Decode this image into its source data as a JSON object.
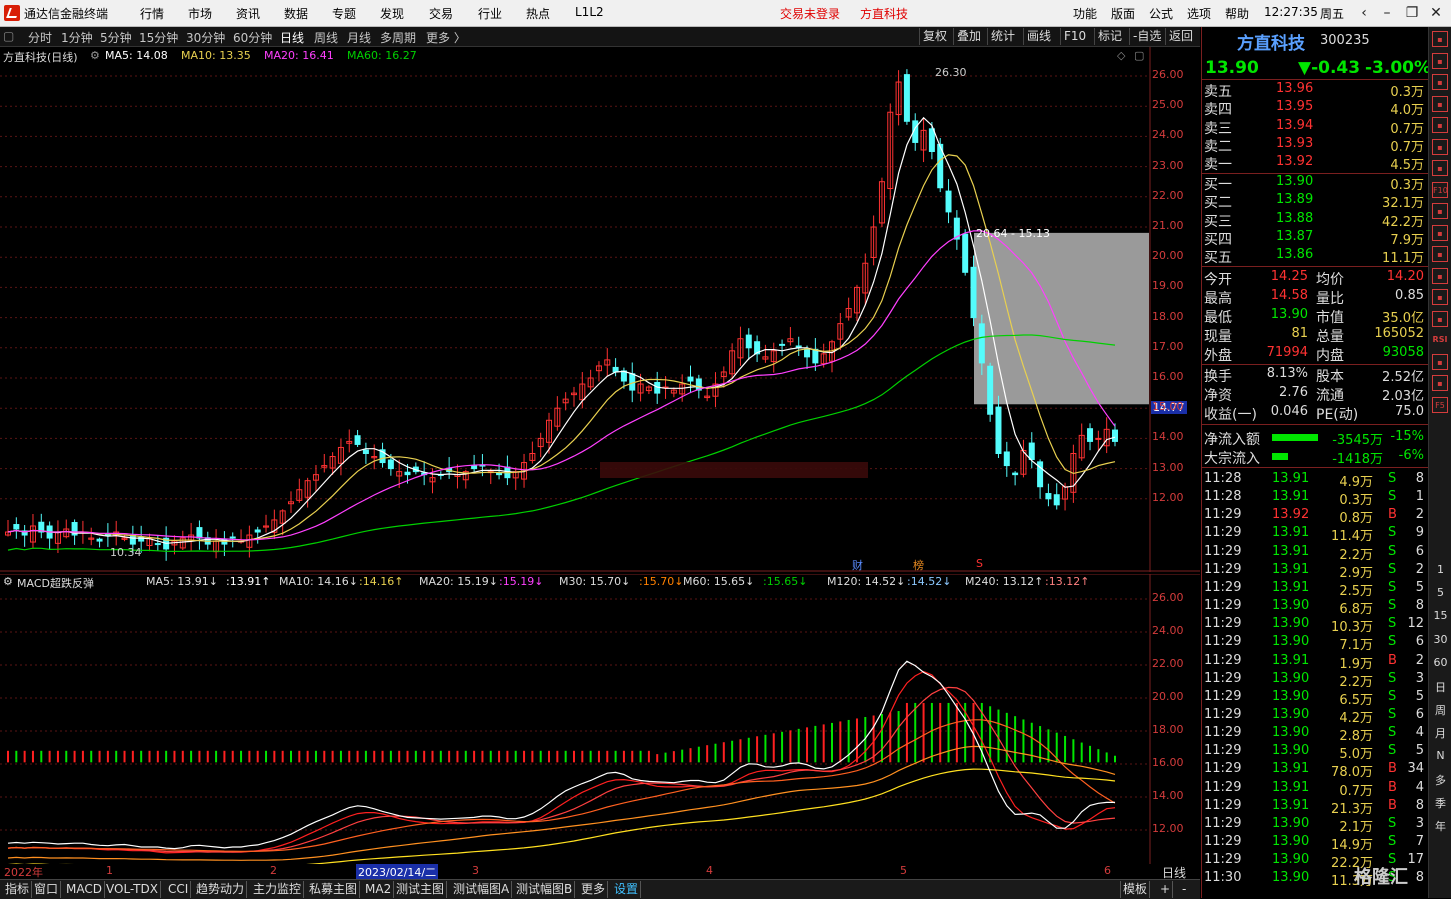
{
  "titlebar": {
    "app_name": "通达信金融终端",
    "menu": [
      "行情",
      "市场",
      "资讯",
      "数据",
      "专题",
      "发现",
      "交易",
      "行业",
      "热点",
      "L1L2"
    ],
    "trade_status": "交易未登录",
    "current_stock": "方直科技",
    "right_menu": [
      "功能",
      "版面",
      "公式",
      "选项",
      "帮助"
    ],
    "time": "12:27:35",
    "weekday": "周五"
  },
  "periodbar": {
    "periods": [
      "分时",
      "1分钟",
      "5分钟",
      "15分钟",
      "30分钟",
      "60分钟",
      "日线",
      "周线",
      "月线",
      "多周期",
      "更多 〉"
    ],
    "active": "日线",
    "tools": [
      "复权",
      "叠加",
      "统计",
      "画线",
      "F10",
      "标记",
      "-自选",
      "返回"
    ]
  },
  "main_chart": {
    "title": "方直科技(日线)",
    "ma5": "MA5: 14.08",
    "ma10": "MA10: 13.35",
    "ma20": "MA20: 16.41",
    "ma60": "MA60: 16.27",
    "high_label": "26.30",
    "low_label": "10.34",
    "range_label": "20.64 - 15.13",
    "price_tag": "14.77",
    "markers": [
      "财",
      "榜",
      "S"
    ],
    "y_ticks": [
      "26.00",
      "25.00",
      "24.00",
      "23.00",
      "22.00",
      "21.00",
      "20.00",
      "19.00",
      "18.00",
      "17.00",
      "16.00",
      "15.00",
      "14.00",
      "13.00",
      "12.00"
    ],
    "colors": {
      "up": "#ff3232",
      "down": "#54fcfc",
      "ma5": "#ffffff",
      "ma10": "#e8d050",
      "ma20": "#ff40ff",
      "ma60": "#00d000",
      "grid": "#7a1f1f"
    }
  },
  "macd_chart": {
    "title": "MACD超跌反弹",
    "legend": [
      {
        "label": "MA5: 13.91↓",
        "val": ":13.91↑"
      },
      {
        "label": "MA10: 14.16↓",
        "val": ":14.16↑"
      },
      {
        "label": "MA20: 15.19↓",
        "val": ":15.19↓"
      },
      {
        "label": "M30: 15.70↓",
        "val": ":15.70↓"
      },
      {
        "label": "M60: 15.65↓",
        "val": ":15.65↓"
      },
      {
        "label": "M120: 14.52↓",
        "val": ":14.52↓"
      },
      {
        "label": "M240: 13.12↑",
        "val": ":13.12↑"
      }
    ],
    "y_ticks": [
      "26.00",
      "24.00",
      "22.00",
      "20.00",
      "18.00",
      "16.00",
      "14.00",
      "12.00"
    ]
  },
  "date_axis": {
    "labels": [
      "2022年",
      "1",
      "2",
      "2023/02/14/二",
      "3",
      "4",
      "5",
      "6"
    ],
    "period": "日线"
  },
  "bottom_tabs": [
    "指标",
    "窗口",
    "MACD",
    "VOL-TDX",
    "CCI",
    "趋势动力",
    "主力监控",
    "私募主图",
    "MA2",
    "测试主图",
    "测试幅图A",
    "测试幅图B",
    "更多",
    "设置"
  ],
  "bottom_right": [
    "模板",
    "+",
    "-"
  ],
  "quote": {
    "name": "方直科技",
    "code": "300235",
    "price": "13.90",
    "change": "▼-0.43",
    "pct": "-3.00%",
    "sells": [
      {
        "label": "卖五",
        "price": "13.96",
        "vol": "0.3万"
      },
      {
        "label": "卖四",
        "price": "13.95",
        "vol": "4.0万"
      },
      {
        "label": "卖三",
        "price": "13.94",
        "vol": "0.7万"
      },
      {
        "label": "卖二",
        "price": "13.93",
        "vol": "0.7万"
      },
      {
        "label": "卖一",
        "price": "13.92",
        "vol": "4.5万"
      }
    ],
    "buys": [
      {
        "label": "买一",
        "price": "13.90",
        "vol": "0.3万"
      },
      {
        "label": "买二",
        "price": "13.89",
        "vol": "32.1万"
      },
      {
        "label": "买三",
        "price": "13.88",
        "vol": "42.2万"
      },
      {
        "label": "买四",
        "price": "13.87",
        "vol": "7.9万"
      },
      {
        "label": "买五",
        "price": "13.86",
        "vol": "11.1万"
      }
    ],
    "stats": [
      {
        "k1": "今开",
        "v1": "14.25",
        "k2": "均价",
        "v2": "14.20"
      },
      {
        "k1": "最高",
        "v1": "14.58",
        "k2": "量比",
        "v2": "0.85"
      },
      {
        "k1": "最低",
        "v1": "13.90",
        "k2": "市值",
        "v2": "35.0亿"
      },
      {
        "k1": "现量",
        "v1": "81",
        "k2": "总量",
        "v2": "165052"
      },
      {
        "k1": "外盘",
        "v1": "71994",
        "k2": "内盘",
        "v2": "93058"
      }
    ],
    "stats2": [
      {
        "k1": "换手",
        "v1": "8.13%",
        "k2": "股本",
        "v2": "2.52亿"
      },
      {
        "k1": "净资",
        "v1": "2.76",
        "k2": "流通",
        "v2": "2.03亿"
      },
      {
        "k1": "收益(一)",
        "v1": "0.046",
        "k2": "PE(动)",
        "v2": "75.0"
      }
    ],
    "flows": [
      {
        "k": "净流入额",
        "v": "-3545万",
        "p": "-15%"
      },
      {
        "k": "大宗流入",
        "v": "-1418万",
        "p": "-6%"
      }
    ],
    "ticks": [
      {
        "t": "11:28",
        "p": "13.91",
        "v": "4.9万",
        "s": "S",
        "n": "8"
      },
      {
        "t": "11:28",
        "p": "13.91",
        "v": "0.3万",
        "s": "S",
        "n": "1"
      },
      {
        "t": "11:29",
        "p": "13.92",
        "v": "0.8万",
        "s": "B",
        "n": "2"
      },
      {
        "t": "11:29",
        "p": "13.91",
        "v": "11.4万",
        "s": "S",
        "n": "9"
      },
      {
        "t": "11:29",
        "p": "13.91",
        "v": "2.2万",
        "s": "S",
        "n": "6"
      },
      {
        "t": "11:29",
        "p": "13.91",
        "v": "2.9万",
        "s": "S",
        "n": "2"
      },
      {
        "t": "11:29",
        "p": "13.91",
        "v": "2.5万",
        "s": "S",
        "n": "5"
      },
      {
        "t": "11:29",
        "p": "13.90",
        "v": "6.8万",
        "s": "S",
        "n": "8"
      },
      {
        "t": "11:29",
        "p": "13.90",
        "v": "10.3万",
        "s": "S",
        "n": "12"
      },
      {
        "t": "11:29",
        "p": "13.90",
        "v": "7.1万",
        "s": "S",
        "n": "6"
      },
      {
        "t": "11:29",
        "p": "13.91",
        "v": "1.9万",
        "s": "B",
        "n": "2"
      },
      {
        "t": "11:29",
        "p": "13.90",
        "v": "2.2万",
        "s": "S",
        "n": "3"
      },
      {
        "t": "11:29",
        "p": "13.90",
        "v": "6.5万",
        "s": "S",
        "n": "5"
      },
      {
        "t": "11:29",
        "p": "13.90",
        "v": "4.2万",
        "s": "S",
        "n": "6"
      },
      {
        "t": "11:29",
        "p": "13.90",
        "v": "2.8万",
        "s": "S",
        "n": "4"
      },
      {
        "t": "11:29",
        "p": "13.90",
        "v": "5.0万",
        "s": "S",
        "n": "5"
      },
      {
        "t": "11:29",
        "p": "13.91",
        "v": "78.0万",
        "s": "B",
        "n": "34"
      },
      {
        "t": "11:29",
        "p": "13.91",
        "v": "0.7万",
        "s": "B",
        "n": "4"
      },
      {
        "t": "11:29",
        "p": "13.91",
        "v": "21.3万",
        "s": "B",
        "n": "8"
      },
      {
        "t": "11:29",
        "p": "13.90",
        "v": "2.1万",
        "s": "S",
        "n": "3"
      },
      {
        "t": "11:29",
        "p": "13.90",
        "v": "14.9万",
        "s": "S",
        "n": "7"
      },
      {
        "t": "11:29",
        "p": "13.90",
        "v": "22.2万",
        "s": "S",
        "n": "17"
      },
      {
        "t": "11:30",
        "p": "13.90",
        "v": "11.3万",
        "s": "S",
        "n": "8"
      }
    ]
  },
  "iconstrip": {
    "icons": [
      "arrow-up-icon",
      "grid-icon",
      "chart-icon",
      "bar-icon",
      "list-icon",
      "trend-icon",
      "candle-icon",
      "f10-icon",
      "ten-icon",
      "table-icon",
      "fz-icon",
      "fl-icon",
      "circle-icon",
      "wave-icon",
      "rsi-icon",
      "s-icon",
      "move-icon",
      "f5-icon"
    ],
    "labels": [
      "1",
      "5",
      "15",
      "30",
      "60",
      "日",
      "周",
      "月",
      "N",
      "多",
      "季",
      "年"
    ]
  },
  "watermark": "格隆汇"
}
